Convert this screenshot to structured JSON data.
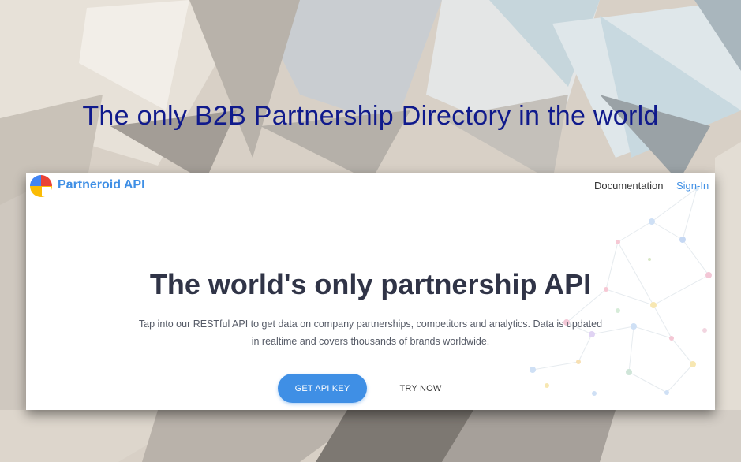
{
  "banner": {
    "headline": "The only B2B Partnership Directory in the world"
  },
  "header": {
    "brand": "Partneroid API",
    "nav": {
      "documentation": "Documentation",
      "sign_in": "Sign-In"
    }
  },
  "hero": {
    "title": "The world's only partnership API",
    "description": "Tap into our RESTful API to get data on company partnerships, competitors and analytics. Data is updated in realtime and covers thousands of brands worldwide.",
    "primary_button": "GET API KEY",
    "secondary_button": "TRY NOW"
  },
  "colors": {
    "accent": "#3f8fe5",
    "headline": "#101a8c",
    "title": "#303447"
  },
  "icons": [
    "partneroid-logo-icon"
  ]
}
